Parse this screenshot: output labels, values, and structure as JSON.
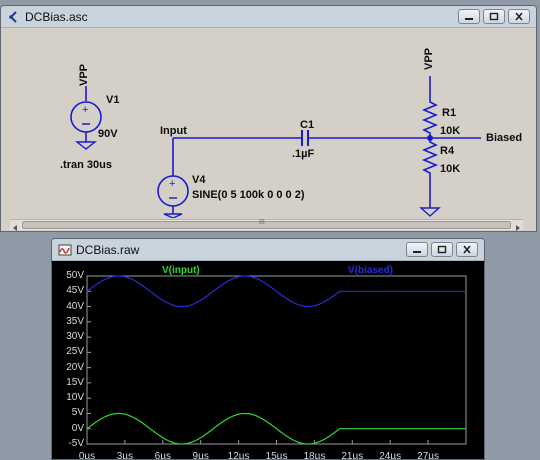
{
  "schematic_window": {
    "title": "DCBias.asc",
    "hscroll_glyph": "III"
  },
  "schematic": {
    "v1": {
      "net_label": "VPP",
      "name": "V1",
      "value": "90V"
    },
    "directive": ".tran 30us",
    "input_net": "Input",
    "c1": {
      "name": "C1",
      "value": ".1µF"
    },
    "r1": {
      "name": "R1",
      "value": "10K"
    },
    "r4": {
      "name": "R4",
      "value": "10K"
    },
    "top_net": "VPP",
    "output_net": "Biased",
    "v4": {
      "name": "V4",
      "value": "SINE(0 5 100k 0 0 0 2)"
    }
  },
  "waveform_window": {
    "title": "DCBias.raw",
    "traces": [
      {
        "label": "V(input)",
        "color": "#33d633"
      },
      {
        "label": "V(biased)",
        "color": "#2a2ad8"
      }
    ],
    "y_ticks": [
      "50V",
      "45V",
      "40V",
      "35V",
      "30V",
      "25V",
      "20V",
      "15V",
      "10V",
      "5V",
      "0V",
      "-5V"
    ],
    "x_ticks": [
      "0µs",
      "3µs",
      "6µs",
      "9µs",
      "12µs",
      "15µs",
      "18µs",
      "21µs",
      "24µs",
      "27µs"
    ]
  },
  "chart_data": {
    "type": "line",
    "xlim": [
      0,
      30
    ],
    "ylim": [
      -5,
      50
    ],
    "grid": false,
    "legend": "top",
    "series": [
      {
        "name": "V(input)",
        "color": "#33d633",
        "x": [
          0,
          2.5,
          5,
          7.5,
          10,
          12.5,
          15,
          17.5,
          20,
          20.01,
          30
        ],
        "y": [
          0,
          5,
          0,
          -5,
          0,
          5,
          0,
          -5,
          0,
          0,
          0
        ]
      },
      {
        "name": "V(biased)",
        "color": "#2a2ad8",
        "x": [
          0,
          2.5,
          5,
          7.5,
          10,
          12.5,
          15,
          17.5,
          20,
          20.01,
          30
        ],
        "y": [
          45,
          50,
          45,
          40,
          45,
          50,
          45,
          40,
          45,
          45,
          45
        ]
      }
    ]
  }
}
